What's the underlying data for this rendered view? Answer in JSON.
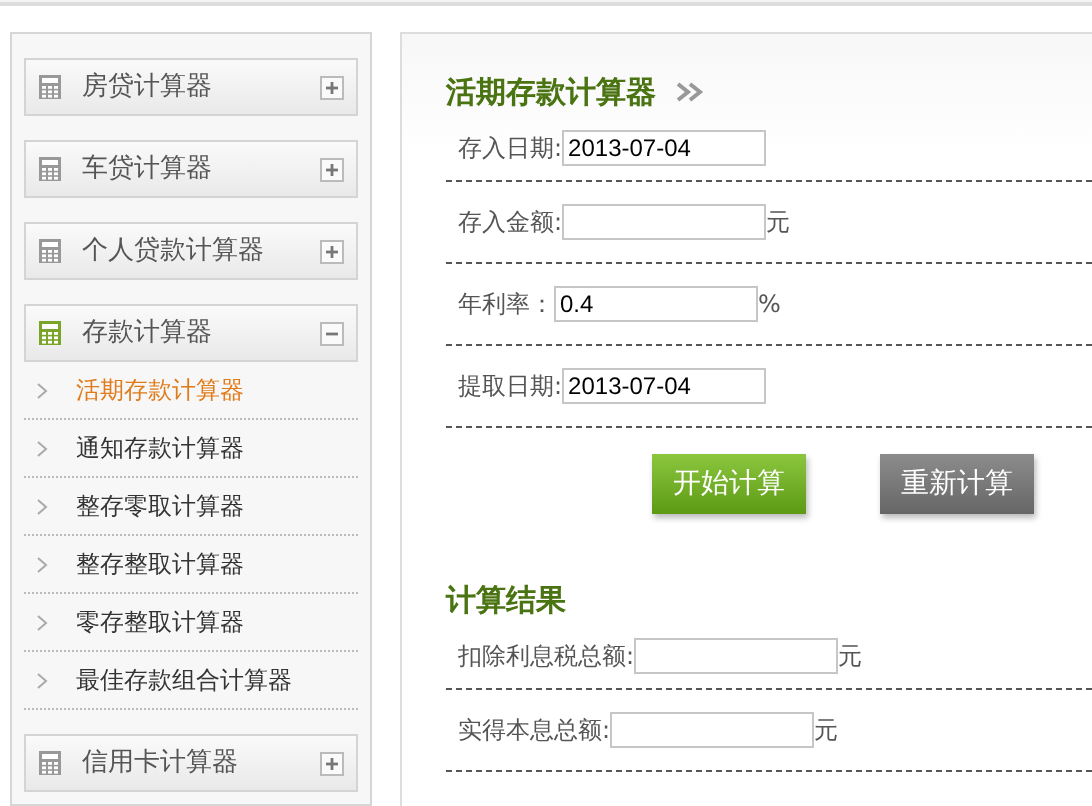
{
  "sidebar": {
    "groups": [
      {
        "label": "房贷计算器",
        "expanded": false
      },
      {
        "label": "车贷计算器",
        "expanded": false
      },
      {
        "label": "个人贷款计算器",
        "expanded": false
      },
      {
        "label": "存款计算器",
        "expanded": true,
        "items": [
          {
            "label": "活期存款计算器",
            "selected": true
          },
          {
            "label": "通知存款计算器",
            "selected": false
          },
          {
            "label": "整存零取计算器",
            "selected": false
          },
          {
            "label": "整存整取计算器",
            "selected": false
          },
          {
            "label": "零存整取计算器",
            "selected": false
          },
          {
            "label": "最佳存款组合计算器",
            "selected": false
          }
        ]
      },
      {
        "label": "信用卡计算器",
        "expanded": false
      }
    ]
  },
  "calculator": {
    "title": "活期存款计算器",
    "fields": [
      {
        "label": "存入日期:",
        "value": "2013-07-04"
      },
      {
        "label": "存入金额:",
        "unit": "元"
      },
      {
        "label": "年利率：",
        "value": "0.4",
        "unit": "%"
      },
      {
        "label": "提取日期:",
        "value": "2013-07-04"
      }
    ],
    "buttons": [
      {
        "label": "开始计算",
        "kind": "primary"
      },
      {
        "label": "重新计算",
        "kind": "secondary"
      }
    ]
  },
  "results": {
    "title": "计算结果",
    "fields": [
      {
        "label": "扣除利息税总额:",
        "unit": "元"
      },
      {
        "label": "实得本息总额:",
        "unit": "元"
      }
    ]
  }
}
